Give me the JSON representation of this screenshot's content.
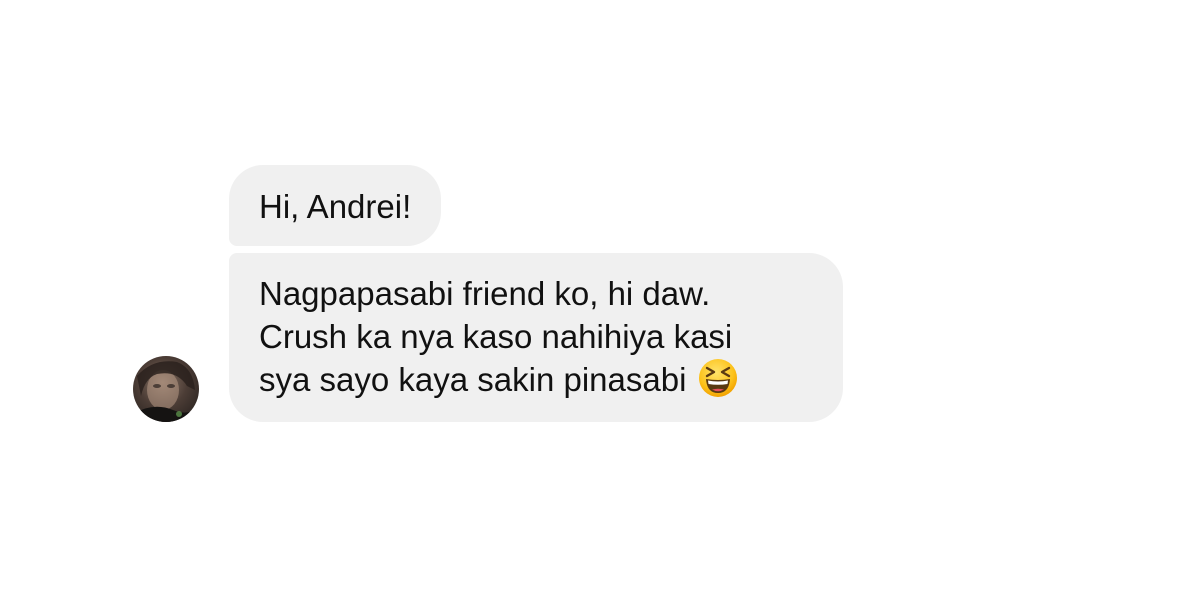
{
  "messages": [
    {
      "lines": [
        "Hi, Andrei!"
      ]
    },
    {
      "lines": [
        "Nagpapasabi friend ko, hi daw.",
        "Crush ka nya kaso nahihiya kasi",
        "sya sayo kaya sakin pinasabi"
      ],
      "emoji": "grinning-squinting-face-icon"
    }
  ],
  "sender": {
    "avatar": "sender-avatar"
  },
  "colors": {
    "bubble_background": "#f0f0f0",
    "text": "#111111",
    "page_background": "#ffffff"
  }
}
